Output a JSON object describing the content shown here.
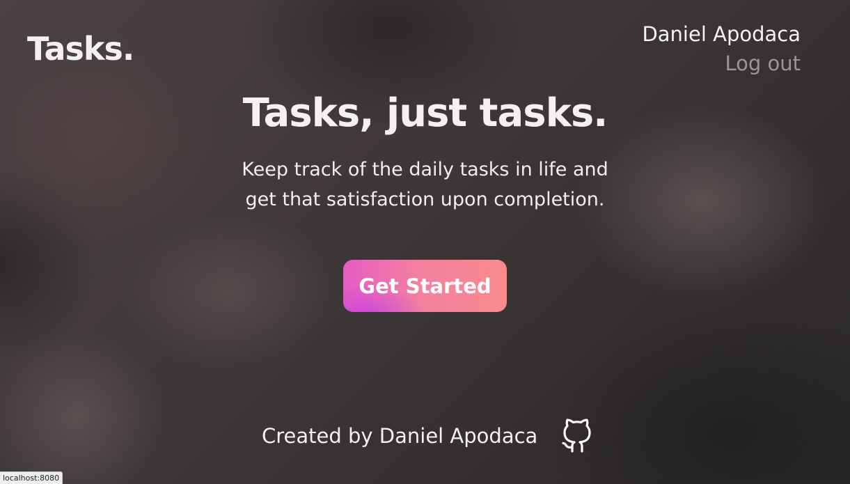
{
  "header": {
    "brand": "Tasks.",
    "user_name": "Daniel Apodaca",
    "logout_label": "Log out"
  },
  "hero": {
    "title": "Tasks, just tasks.",
    "subtitle_line1": "Keep track of the daily tasks in life and",
    "subtitle_line2": "get that satisfaction upon completion.",
    "cta_label": "Get Started"
  },
  "footer": {
    "credit": "Created by Daniel Apodaca",
    "link_icon": "github-icon"
  },
  "status_bar": {
    "url": "localhost:8080"
  },
  "colors": {
    "cta_gradient_start": "#e45cc4",
    "cta_gradient_end": "#f98a8c",
    "logout_text": "#9b9595"
  }
}
